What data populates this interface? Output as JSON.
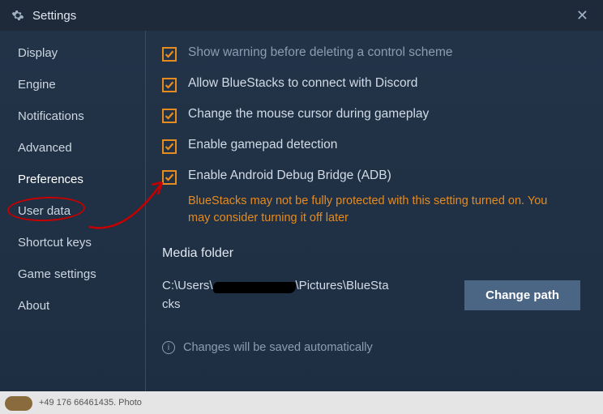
{
  "header": {
    "title": "Settings"
  },
  "sidebar": {
    "items": [
      {
        "label": "Display"
      },
      {
        "label": "Engine"
      },
      {
        "label": "Notifications"
      },
      {
        "label": "Advanced"
      },
      {
        "label": "Preferences"
      },
      {
        "label": "User data"
      },
      {
        "label": "Shortcut keys"
      },
      {
        "label": "Game settings"
      },
      {
        "label": "About"
      }
    ],
    "active_index": 4
  },
  "options": [
    {
      "label": "Show warning before deleting a control scheme",
      "checked": true,
      "dim": true
    },
    {
      "label": "Allow BlueStacks to connect with Discord",
      "checked": true
    },
    {
      "label": "Change the mouse cursor during gameplay",
      "checked": true
    },
    {
      "label": "Enable gamepad detection",
      "checked": true
    },
    {
      "label": "Enable Android Debug Bridge (ADB)",
      "checked": true
    }
  ],
  "adb_warning": "BlueStacks may not be fully protected with this setting turned on. You may consider turning it off later",
  "media_folder": {
    "title": "Media folder",
    "path_prefix": "C:\\Users\\",
    "path_suffix": "\\Pictures\\BlueStacks",
    "button": "Change path"
  },
  "footer": "Changes will be saved automatically",
  "bg_snippet": "+49 176 66461435.  Photo"
}
